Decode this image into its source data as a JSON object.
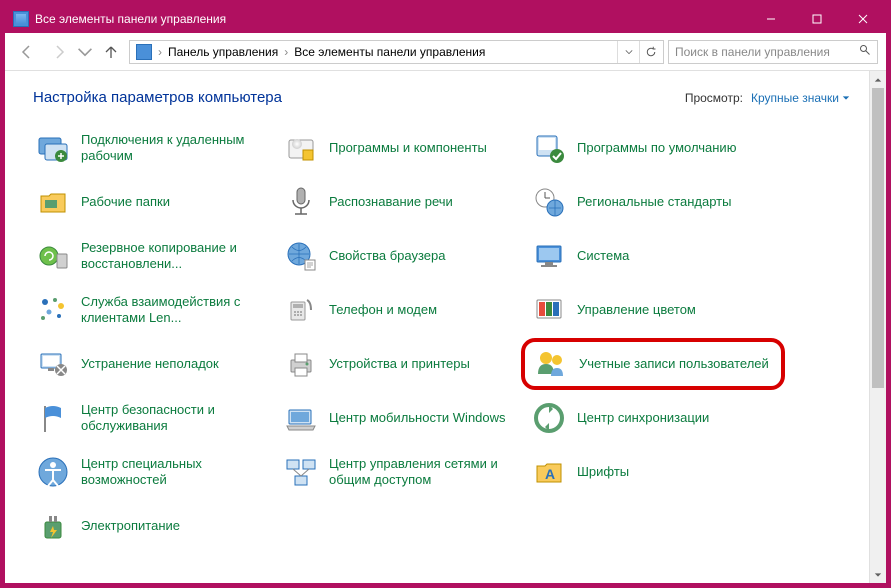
{
  "window": {
    "title": "Все элементы панели управления"
  },
  "breadcrumb": {
    "root": "Панель управления",
    "current": "Все элементы панели управления"
  },
  "search": {
    "placeholder": "Поиск в панели управления"
  },
  "heading": "Настройка параметров компьютера",
  "viewby": {
    "label": "Просмотр:",
    "value": "Крупные значки"
  },
  "items": [
    {
      "label": "Подключения к удаленным рабочим"
    },
    {
      "label": "Программы и компоненты"
    },
    {
      "label": "Программы по умолчанию"
    },
    {
      "label": "Рабочие папки"
    },
    {
      "label": "Распознавание речи"
    },
    {
      "label": "Региональные стандарты"
    },
    {
      "label": "Резервное копирование и восстановлени..."
    },
    {
      "label": "Свойства браузера"
    },
    {
      "label": "Система"
    },
    {
      "label": "Служба взаимодействия с клиентами Len..."
    },
    {
      "label": "Телефон и модем"
    },
    {
      "label": "Управление цветом"
    },
    {
      "label": "Устранение неполадок"
    },
    {
      "label": "Устройства и принтеры"
    },
    {
      "label": "Учетные записи пользователей"
    },
    {
      "label": "Центр безопасности и обслуживания"
    },
    {
      "label": "Центр мобильности Windows"
    },
    {
      "label": "Центр синхронизации"
    },
    {
      "label": "Центр специальных возможностей"
    },
    {
      "label": "Центр управления сетями и общим доступом"
    },
    {
      "label": "Шрифты"
    },
    {
      "label": "Электропитание"
    }
  ]
}
